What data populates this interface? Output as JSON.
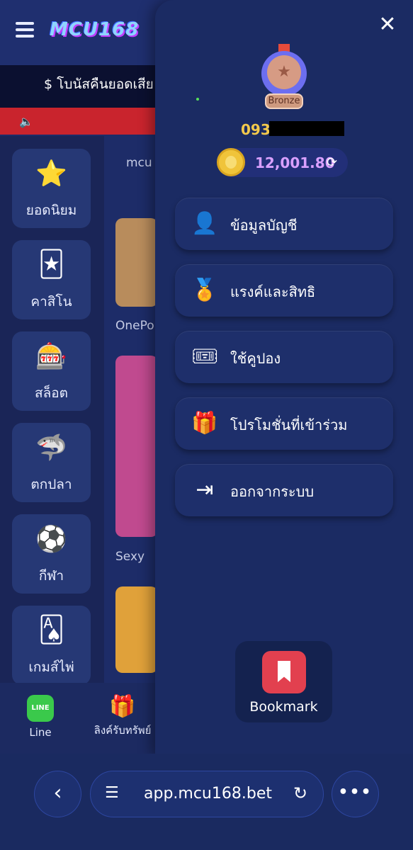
{
  "header": {
    "logo_text": "MCU168",
    "bonus_text": "$ โบนัสคืนยอดเสีย (",
    "content_snippet": "mcu"
  },
  "categories": [
    {
      "label": "ยอดนิยม",
      "icon": "star-trophy-icon"
    },
    {
      "label": "คาสิโน",
      "icon": "casino-cards-icon"
    },
    {
      "label": "สล็อต",
      "icon": "slot-machine-icon"
    },
    {
      "label": "ตกปลา",
      "icon": "fish-shark-icon"
    },
    {
      "label": "กีฬา",
      "icon": "sports-ball-icon"
    },
    {
      "label": "เกมส์ไพ่",
      "icon": "playing-cards-icon"
    }
  ],
  "content": {
    "item1_label": "OnePo",
    "item2_label": "Sexy"
  },
  "bottom_nav": {
    "line_label": "Line",
    "line_icon_text": "LINE",
    "gift_label": "ลิงค์รับทรัพย์"
  },
  "drawer": {
    "rank_badge": "Bronze",
    "phone_prefix": "093",
    "balance": "12,001.80",
    "menu": [
      {
        "label": "ข้อมูลบัญชี",
        "icon": "user-icon"
      },
      {
        "label": "แรงค์และสิทธิ",
        "icon": "rank-medal-icon"
      },
      {
        "label": "ใช้คูปอง",
        "icon": "coupon-icon"
      },
      {
        "label": "โปรโมชั่นที่เข้าร่วม",
        "icon": "gift-icon"
      },
      {
        "label": "ออกจากระบบ",
        "icon": "logout-icon"
      }
    ],
    "bookmark_label": "Bookmark"
  },
  "browser": {
    "url": "app.mcu168.bet"
  },
  "colors": {
    "gold": "#f3c94c",
    "balance": "#d9a0ff",
    "marquee": "#c9242d"
  }
}
